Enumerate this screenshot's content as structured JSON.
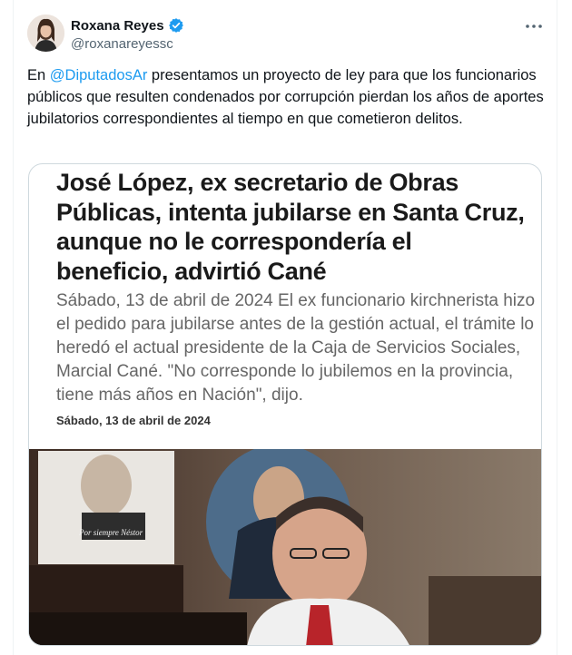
{
  "user": {
    "name": "Roxana Reyes",
    "handle": "@roxanareyessc"
  },
  "tweet": {
    "prefix": "En ",
    "mention": "@DiputadosAr",
    "suffix": " presentamos un proyecto de ley para que los funcionarios públicos que resulten condenados por corrupción pierdan los años de aportes jubilatorios correspondientes al tiempo en que cometieron delitos."
  },
  "article": {
    "headline": "José López, ex secretario de Obras Públicas, intenta jubilarse en Santa Cruz, aunque no le correspondería el beneficio, advirtió Cané",
    "summary": "Sábado, 13 de abril de 2024 El ex funcionario kirchnerista hizo el pedido para jubilarse antes de la gestión actual, el trámite lo heredó el actual presidente de la Caja de Servicios Sociales, Marcial Cané. \"No corresponde lo jubilemos en la provincia, tiene más años en Nación\", dijo.",
    "date": "Sábado, 13 de abril de 2024",
    "photo_caption": "Por siempre Néstor"
  },
  "colors": {
    "accent": "#1d9bf0",
    "text": "#0f1419",
    "muted": "#536471"
  },
  "icons": [
    "verified-badge-icon",
    "more-options-icon"
  ]
}
